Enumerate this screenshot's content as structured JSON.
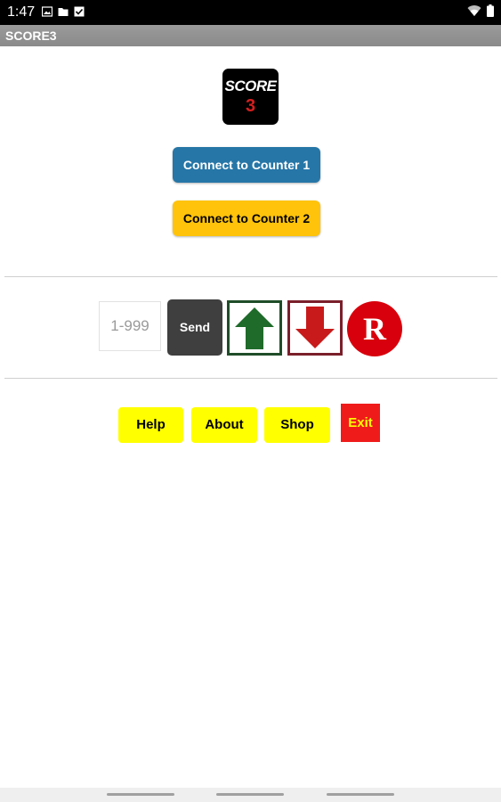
{
  "status_bar": {
    "time": "1:47",
    "left_icons": [
      "image-icon",
      "folder-icon",
      "checkbox-icon"
    ],
    "right_icons": [
      "wifi-icon",
      "battery-icon"
    ]
  },
  "app_bar": {
    "title": "SCORE3"
  },
  "logo": {
    "word": "SCORE",
    "number": "3"
  },
  "connect": {
    "counter1_label": "Connect to Counter 1",
    "counter2_label": "Connect to Counter 2"
  },
  "controls": {
    "input_placeholder": "1-999",
    "input_value": "",
    "send_label": "Send",
    "up_icon": "arrow-up-icon",
    "down_icon": "arrow-down-icon",
    "reset_label": "R"
  },
  "menu": {
    "help_label": "Help",
    "about_label": "About",
    "shop_label": "Shop",
    "exit_label": "Exit"
  },
  "colors": {
    "connect1": "#2676a7",
    "connect2": "#ffc30b",
    "send": "#3f3f3f",
    "up_green": "#1f6b2a",
    "down_red": "#c81a1a",
    "reset_red": "#d8000c",
    "menu_yellow": "#ffff00",
    "exit_red": "#ef1b1b"
  }
}
